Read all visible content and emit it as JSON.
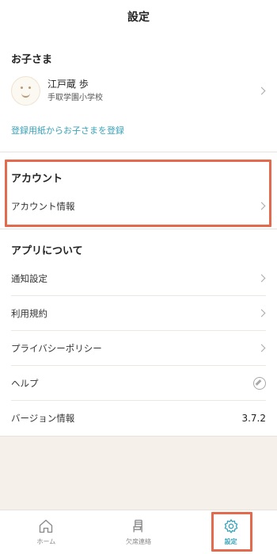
{
  "header": {
    "title": "設定"
  },
  "children_section": {
    "title": "お子さま",
    "child": {
      "name": "江戸蔵 歩",
      "school": "手取学園小学校"
    },
    "register_link": "登録用紙からお子さまを登録"
  },
  "account_section": {
    "title": "アカウント",
    "items": [
      {
        "label": "アカウント情報"
      }
    ]
  },
  "about_section": {
    "title": "アプリについて",
    "items": [
      {
        "label": "通知設定",
        "icon": "chevron-right-icon"
      },
      {
        "label": "利用規約",
        "icon": "chevron-right-icon"
      },
      {
        "label": "プライバシーポリシー",
        "icon": "chevron-right-icon"
      },
      {
        "label": "ヘルプ",
        "icon": "compass-icon"
      },
      {
        "label": "バージョン情報",
        "value": "3.7.2"
      }
    ]
  },
  "tabbar": {
    "items": [
      {
        "label": "ホーム",
        "icon": "home-icon"
      },
      {
        "label": "欠席連絡",
        "icon": "chair-icon"
      },
      {
        "label": "設定",
        "icon": "gear-icon",
        "active": true
      }
    ]
  },
  "colors": {
    "accent": "#3aa3b9",
    "highlight": "#e36a4c",
    "background_beige": "#f5f1ea"
  }
}
